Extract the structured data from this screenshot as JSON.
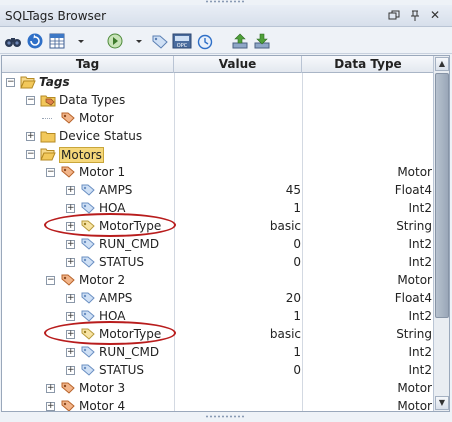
{
  "window": {
    "title": "SQLTags Browser",
    "buttons": [
      "restore",
      "pin",
      "close"
    ]
  },
  "toolbar": {
    "icons": [
      "binoculars-icon",
      "refresh-icon",
      "table-icon",
      "dropdown-icon",
      "add-tag-icon",
      "dropdown-icon",
      "tag-icon",
      "opc-icon",
      "clock-icon",
      "export-icon",
      "import-icon"
    ],
    "opc_text": "OPC"
  },
  "columns": {
    "tag": "Tag",
    "value": "Value",
    "datatype": "Data Type"
  },
  "rows": [
    {
      "label": "Tags",
      "value": "",
      "type": "",
      "bold": true
    },
    {
      "label": "Data Types",
      "value": "",
      "type": ""
    },
    {
      "label": "Motor",
      "value": "",
      "type": ""
    },
    {
      "label": "Device Status",
      "value": "",
      "type": ""
    },
    {
      "label": "Motors",
      "value": "",
      "type": "",
      "selected": true
    },
    {
      "label": "Motor 1",
      "value": "",
      "type": "Motor"
    },
    {
      "label": "AMPS",
      "value": "45",
      "type": "Float4"
    },
    {
      "label": "HOA",
      "value": "1",
      "type": "Int2"
    },
    {
      "label": "MotorType",
      "value": "basic",
      "type": "String",
      "highlighted": true
    },
    {
      "label": "RUN_CMD",
      "value": "0",
      "type": "Int2"
    },
    {
      "label": "STATUS",
      "value": "0",
      "type": "Int2"
    },
    {
      "label": "Motor 2",
      "value": "",
      "type": "Motor"
    },
    {
      "label": "AMPS",
      "value": "20",
      "type": "Float4"
    },
    {
      "label": "HOA",
      "value": "1",
      "type": "Int2"
    },
    {
      "label": "MotorType",
      "value": "basic",
      "type": "String",
      "highlighted": true
    },
    {
      "label": "RUN_CMD",
      "value": "1",
      "type": "Int2"
    },
    {
      "label": "STATUS",
      "value": "0",
      "type": "Int2"
    },
    {
      "label": "Motor 3",
      "value": "",
      "type": "Motor"
    },
    {
      "label": "Motor 4",
      "value": "",
      "type": "Motor"
    }
  ],
  "colors": {
    "highlight_ring": "#b81c1c",
    "selection": "#f5d77a",
    "folder": "#e8b84a",
    "tag_icon": "#7fa7d8",
    "udt_icon": "#e0824a"
  }
}
